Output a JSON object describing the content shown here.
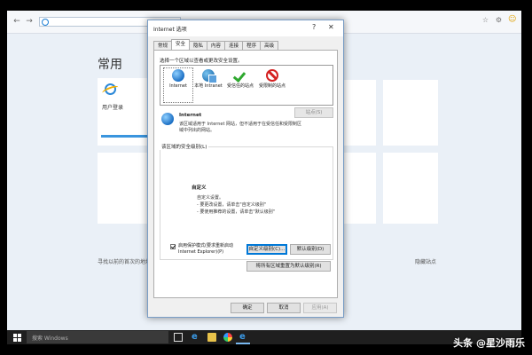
{
  "browser": {
    "back_glyph": "←",
    "forward_glyph": "→",
    "icons": [
      "star-icon",
      "gear-icon",
      "smiley-icon"
    ]
  },
  "newtab": {
    "heading": "常用",
    "tile_label": "用户登录",
    "hint": "寻找以前的首次的地址",
    "hide_link": "隐藏站点"
  },
  "dialog": {
    "title": "Internet 选项",
    "help": "?",
    "close": "✕",
    "tabs": [
      "常规",
      "安全",
      "隐私",
      "内容",
      "连接",
      "程序",
      "高级"
    ],
    "active_tab": "安全",
    "instruction": "选择一个区域以查看或更改安全设置。",
    "zones": [
      {
        "name": "Internet",
        "icon": "globe-icon"
      },
      {
        "name": "本地 Intranet",
        "icon": "intranet-icon"
      },
      {
        "name": "受信任的站点",
        "icon": "checkmark-icon"
      },
      {
        "name": "受限制的站点",
        "icon": "no-entry-icon"
      }
    ],
    "selected_zone_name": "Internet",
    "selected_zone_desc": "该区域适用于 Internet 网站，但不适用于在受信任和受限制区域中列出的网站。",
    "sites_button": "站点(S)",
    "level_group_title": "该区域的安全级别(L)",
    "level_custom": "自定义",
    "level_settings": [
      "自定义设置。",
      "- 要更改设置，请单击\"自定义级别\"",
      "- 要使用推荐的设置，请单击\"默认级别\""
    ],
    "protected_mode_label": "启用保护模式(要求重新启动 Internet Explorer)(P)",
    "protected_mode_checked": true,
    "custom_level_button": "自定义级别(C)...",
    "default_level_button": "默认级别(D)",
    "reset_all_button": "将所有区域重置为默认级别(R)",
    "ok_button": "确定",
    "cancel_button": "取消",
    "apply_button": "应用(A)"
  },
  "taskbar": {
    "search_placeholder": "搜索 Windows"
  },
  "watermark": "头条 @星沙雨乐"
}
